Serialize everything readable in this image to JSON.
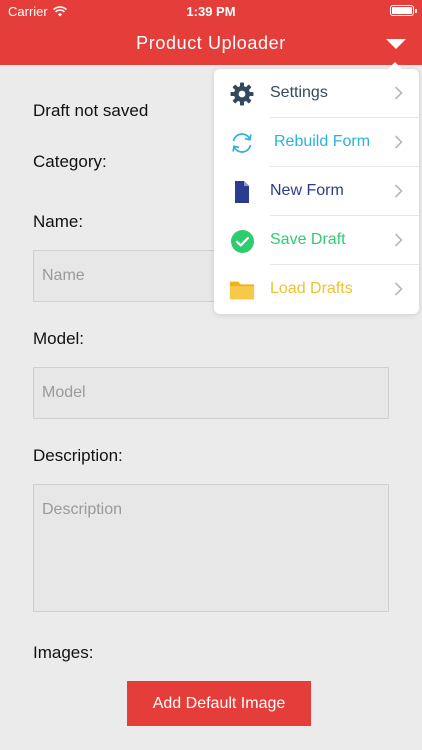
{
  "status_bar": {
    "carrier": "Carrier",
    "time": "1:39 PM"
  },
  "header": {
    "title": "Product Uploader"
  },
  "form": {
    "draft_status": "Draft not saved",
    "category_label": "Category:",
    "name_label": "Name:",
    "name_placeholder": "Name",
    "model_label": "Model:",
    "model_placeholder": "Model",
    "description_label": "Description:",
    "description_placeholder": "Description",
    "images_label": "Images:",
    "add_image_button": "Add Default Image"
  },
  "menu": {
    "items": [
      {
        "label": "Settings",
        "icon": "gear-icon",
        "color": "#34495e"
      },
      {
        "label": "Rebuild Form",
        "icon": "refresh-icon",
        "color": "#2bb3d8"
      },
      {
        "label": "New Form",
        "icon": "document-icon",
        "color": "#2b3c8f"
      },
      {
        "label": "Save Draft",
        "icon": "check-circle-icon",
        "color": "#2ecc71"
      },
      {
        "label": "Load Drafts",
        "icon": "folder-icon",
        "color": "#f2c12e"
      }
    ]
  },
  "colors": {
    "accent": "#e43d3a",
    "background": "#ebebeb"
  }
}
